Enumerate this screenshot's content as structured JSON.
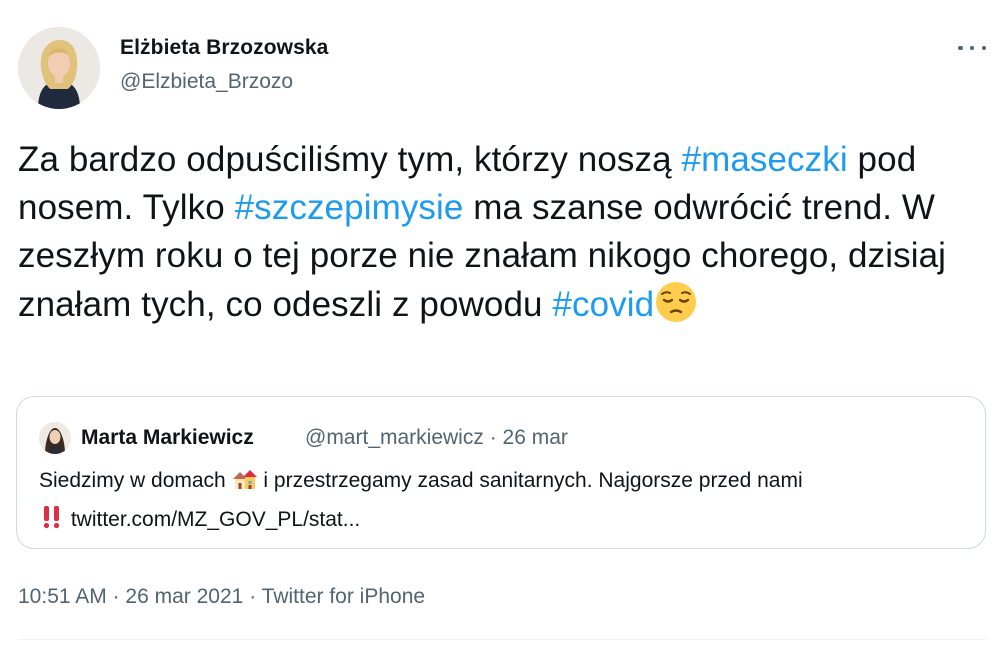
{
  "tweet": {
    "author_name": "Elżbieta Brzozowska",
    "author_handle": "@Elzbieta_Brzozo",
    "text": {
      "part1": "Za bardzo odpuściliśmy tym, którzy noszą ",
      "hashtag1": "#maseczki",
      "part2": " pod nosem. Tylko ",
      "hashtag2": "#szczepimysie",
      "part3": " ma szanse odwrócić trend. W zeszłym roku o tej porze nie znałam nikogo chorego, dzisiaj znałam tych, co odeszli z powodu ",
      "hashtag3": "#covid",
      "emoji": "pensive-face"
    },
    "timestamp": "10:51 AM",
    "date": "26 mar 2021",
    "source": "Twitter for iPhone",
    "separator": "·"
  },
  "quoted_tweet": {
    "author_name": "Marta Markiewicz",
    "author_handle": "@mart_markiewicz",
    "date": "26 mar",
    "separator": "·",
    "text_part1": "Siedzimy w domach ",
    "emoji1": "houses",
    "text_part2": " i przestrzegamy zasad sanitarnych. Najgorsze przed nami ",
    "emoji2": "double-exclamation-mark",
    "link": "twitter.com/MZ_GOV_PL/stat..."
  },
  "colors": {
    "hashtag": "#1d9bf0",
    "secondary_text": "#536471",
    "primary_text": "#0f1419",
    "border": "#cfd9de"
  }
}
